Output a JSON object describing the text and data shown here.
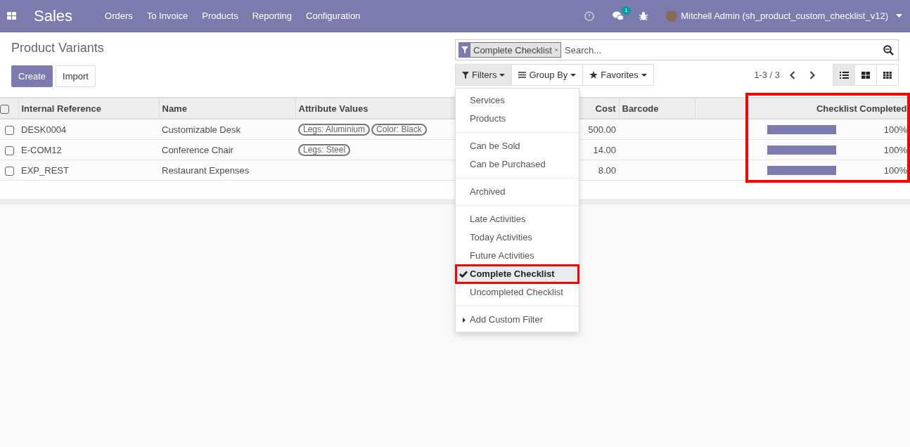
{
  "navbar": {
    "app": "Sales",
    "menu": [
      "Orders",
      "To Invoice",
      "Products",
      "Reporting",
      "Configuration"
    ],
    "message_count": "1",
    "user": "Mitchell Admin (sh_product_custom_checklist_v12)"
  },
  "page": {
    "title": "Product Variants",
    "buttons": [
      {
        "label": "Create",
        "kind": "primary"
      },
      {
        "label": "Import",
        "kind": "secondary"
      }
    ]
  },
  "search": {
    "facet": "Complete Checklist",
    "placeholder": "Search..."
  },
  "search_buttons": [
    {
      "label": "Filters",
      "kind": "filter",
      "selected": true
    },
    {
      "label": "Group By",
      "kind": "bars",
      "selected": false
    },
    {
      "label": "Favorites",
      "kind": "star",
      "selected": false
    }
  ],
  "pager": "1-3 / 3",
  "views": [
    {
      "kind": "list",
      "selected": true
    },
    {
      "kind": "kanban",
      "selected": false
    },
    {
      "kind": "grid",
      "selected": false
    }
  ],
  "filters_menu": [
    {
      "items": [
        {
          "label": "Services",
          "checked": false,
          "highlighted": false
        },
        {
          "label": "Products",
          "checked": false,
          "highlighted": false
        }
      ]
    },
    {
      "items": [
        {
          "label": "Can be Sold",
          "checked": false,
          "highlighted": false
        },
        {
          "label": "Can be Purchased",
          "checked": false,
          "highlighted": false
        }
      ]
    },
    {
      "items": [
        {
          "label": "Archived",
          "checked": false,
          "highlighted": false
        }
      ]
    },
    {
      "items": [
        {
          "label": "Late Activities",
          "checked": false,
          "highlighted": false
        },
        {
          "label": "Today Activities",
          "checked": false,
          "highlighted": false
        },
        {
          "label": "Future Activities",
          "checked": false,
          "highlighted": false
        },
        {
          "label": "Complete Checklist",
          "checked": true,
          "highlighted": true
        },
        {
          "label": "Uncompleted Checklist",
          "checked": false,
          "highlighted": false
        }
      ]
    }
  ],
  "custom_filter": "Add Custom Filter",
  "table": {
    "select_all_checked": false,
    "columns": [
      {
        "label": "Internal Reference"
      },
      {
        "label": "Name"
      },
      {
        "label": "Attribute Values"
      },
      {
        "label": "Cost"
      },
      {
        "label": "Barcode"
      },
      {
        "label": "Checklist Completed",
        "highlighted": true
      }
    ],
    "rows": [
      {
        "selected": false,
        "ref": "DESK0004",
        "name": "Customizable Desk",
        "attributes": [
          "Legs: Aluminium",
          "Color: Black"
        ],
        "cost": "500.00",
        "level": 1,
        "reading": "100%"
      },
      {
        "selected": false,
        "ref": "E-COM12",
        "name": "Conference Chair",
        "attributes": [
          "Legs: Steel"
        ],
        "cost": "14.00",
        "level": 1,
        "reading": "100%"
      },
      {
        "selected": false,
        "ref": "EXP_REST",
        "name": "Restaurant Expenses",
        "attributes": [],
        "cost": "8.00",
        "level": 1,
        "reading": "100%"
      }
    ]
  }
}
